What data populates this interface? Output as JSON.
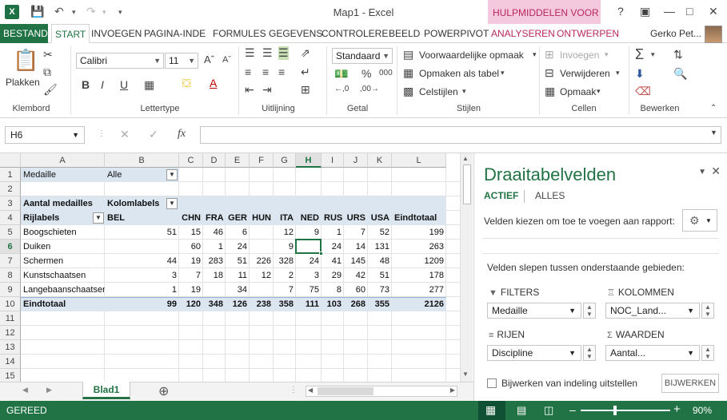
{
  "app": {
    "window_title": "Map1 - Excel",
    "contextual_tab": "HULPMIDDELEN VOOR ...",
    "user": "Gerko Pet..."
  },
  "ribbon_tabs": [
    "BESTAND",
    "START",
    "INVOEGEN",
    "PAGINA-INDE",
    "FORMULES",
    "GEGEVENS",
    "CONTROLERE",
    "BEELD",
    "POWERPIVOT",
    "ANALYSEREN",
    "ONTWERPEN"
  ],
  "ribbon": {
    "clipboard": {
      "paste": "Plakken",
      "label": "Klembord"
    },
    "font": {
      "name": "Calibri",
      "size": "11",
      "label": "Lettertype",
      "bold": "B",
      "italic": "I",
      "underline": "U"
    },
    "alignment": {
      "label": "Uitlijning"
    },
    "number": {
      "format": "Standaard",
      "label": "Getal"
    },
    "styles": {
      "conditional": "Voorwaardelijke opmaak",
      "as_table": "Opmaken als tabel",
      "cell_styles": "Celstijlen",
      "label": "Stijlen"
    },
    "cells": {
      "insert": "Invoegen",
      "delete": "Verwijderen",
      "format": "Opmaak",
      "label": "Cellen"
    },
    "editing": {
      "label": "Bewerken"
    }
  },
  "formula_bar": {
    "name_box": "H6",
    "fx": "fx",
    "value": ""
  },
  "grid": {
    "columns": [
      "A",
      "B",
      "C",
      "D",
      "E",
      "F",
      "G",
      "H",
      "I",
      "J",
      "K",
      "L"
    ],
    "selected_column": "H",
    "selected_row": "6",
    "rows": [
      "1",
      "2",
      "3",
      "4",
      "5",
      "6",
      "7",
      "8",
      "9",
      "10",
      "11",
      "12",
      "13",
      "14",
      "15"
    ],
    "filter_label": "Medaille",
    "filter_value": "Alle",
    "values_header": "Aantal medailles",
    "col_labels": "Kolomlabels",
    "row_labels": "Rijlabels",
    "countries": [
      "BEL",
      "CHN",
      "FRA",
      "GER",
      "HUN",
      "ITA",
      "NED",
      "RUS",
      "URS",
      "USA"
    ],
    "grand_total_label": "Eindtotaal",
    "data": [
      {
        "label": "Boogschieten",
        "vals": [
          "51",
          "15",
          "46",
          "6",
          "",
          "12",
          "9",
          "1",
          "7",
          "52"
        ],
        "total": "199"
      },
      {
        "label": "Duiken",
        "vals": [
          "",
          "60",
          "1",
          "24",
          "",
          "9",
          "",
          "24",
          "14",
          "131"
        ],
        "total": "263"
      },
      {
        "label": "Schermen",
        "vals": [
          "44",
          "19",
          "283",
          "51",
          "226",
          "328",
          "24",
          "41",
          "145",
          "48"
        ],
        "total": "1209"
      },
      {
        "label": "Kunstschaatsen",
        "vals": [
          "3",
          "7",
          "18",
          "11",
          "12",
          "2",
          "3",
          "29",
          "42",
          "51"
        ],
        "total": "178"
      },
      {
        "label": "Langebaanschaatsen",
        "vals": [
          "1",
          "19",
          "",
          "34",
          "",
          "7",
          "75",
          "8",
          "60",
          "73"
        ],
        "total": "277"
      }
    ],
    "totals": {
      "label": "Eindtotaal",
      "vals": [
        "99",
        "120",
        "348",
        "126",
        "238",
        "358",
        "111",
        "103",
        "268",
        "355"
      ],
      "total": "2126"
    }
  },
  "sheet": {
    "tab": "Blad1"
  },
  "pane": {
    "title": "Draaitabelvelden",
    "tab_active": "ACTIEF",
    "tab_all": "ALLES",
    "choose_text": "Velden kiezen om toe te voegen aan rapport:",
    "drag_text": "Velden slepen tussen onderstaande gebieden:",
    "filters": {
      "title": "FILTERS",
      "value": "Medaille"
    },
    "columns": {
      "title": "KOLOMMEN",
      "value": "NOC_Land..."
    },
    "rows": {
      "title": "RIJEN",
      "value": "Discipline"
    },
    "values": {
      "title": "WAARDEN",
      "value": "Aantal..."
    },
    "defer_label": "Bijwerken van indeling uitstellen",
    "update_button": "BIJWERKEN"
  },
  "status": {
    "mode": "GEREED",
    "zoom": "90%"
  },
  "colors": {
    "excel_green": "#217346",
    "pivot_context": "#b8285c",
    "pivot_highlight": "#dce6f1"
  }
}
